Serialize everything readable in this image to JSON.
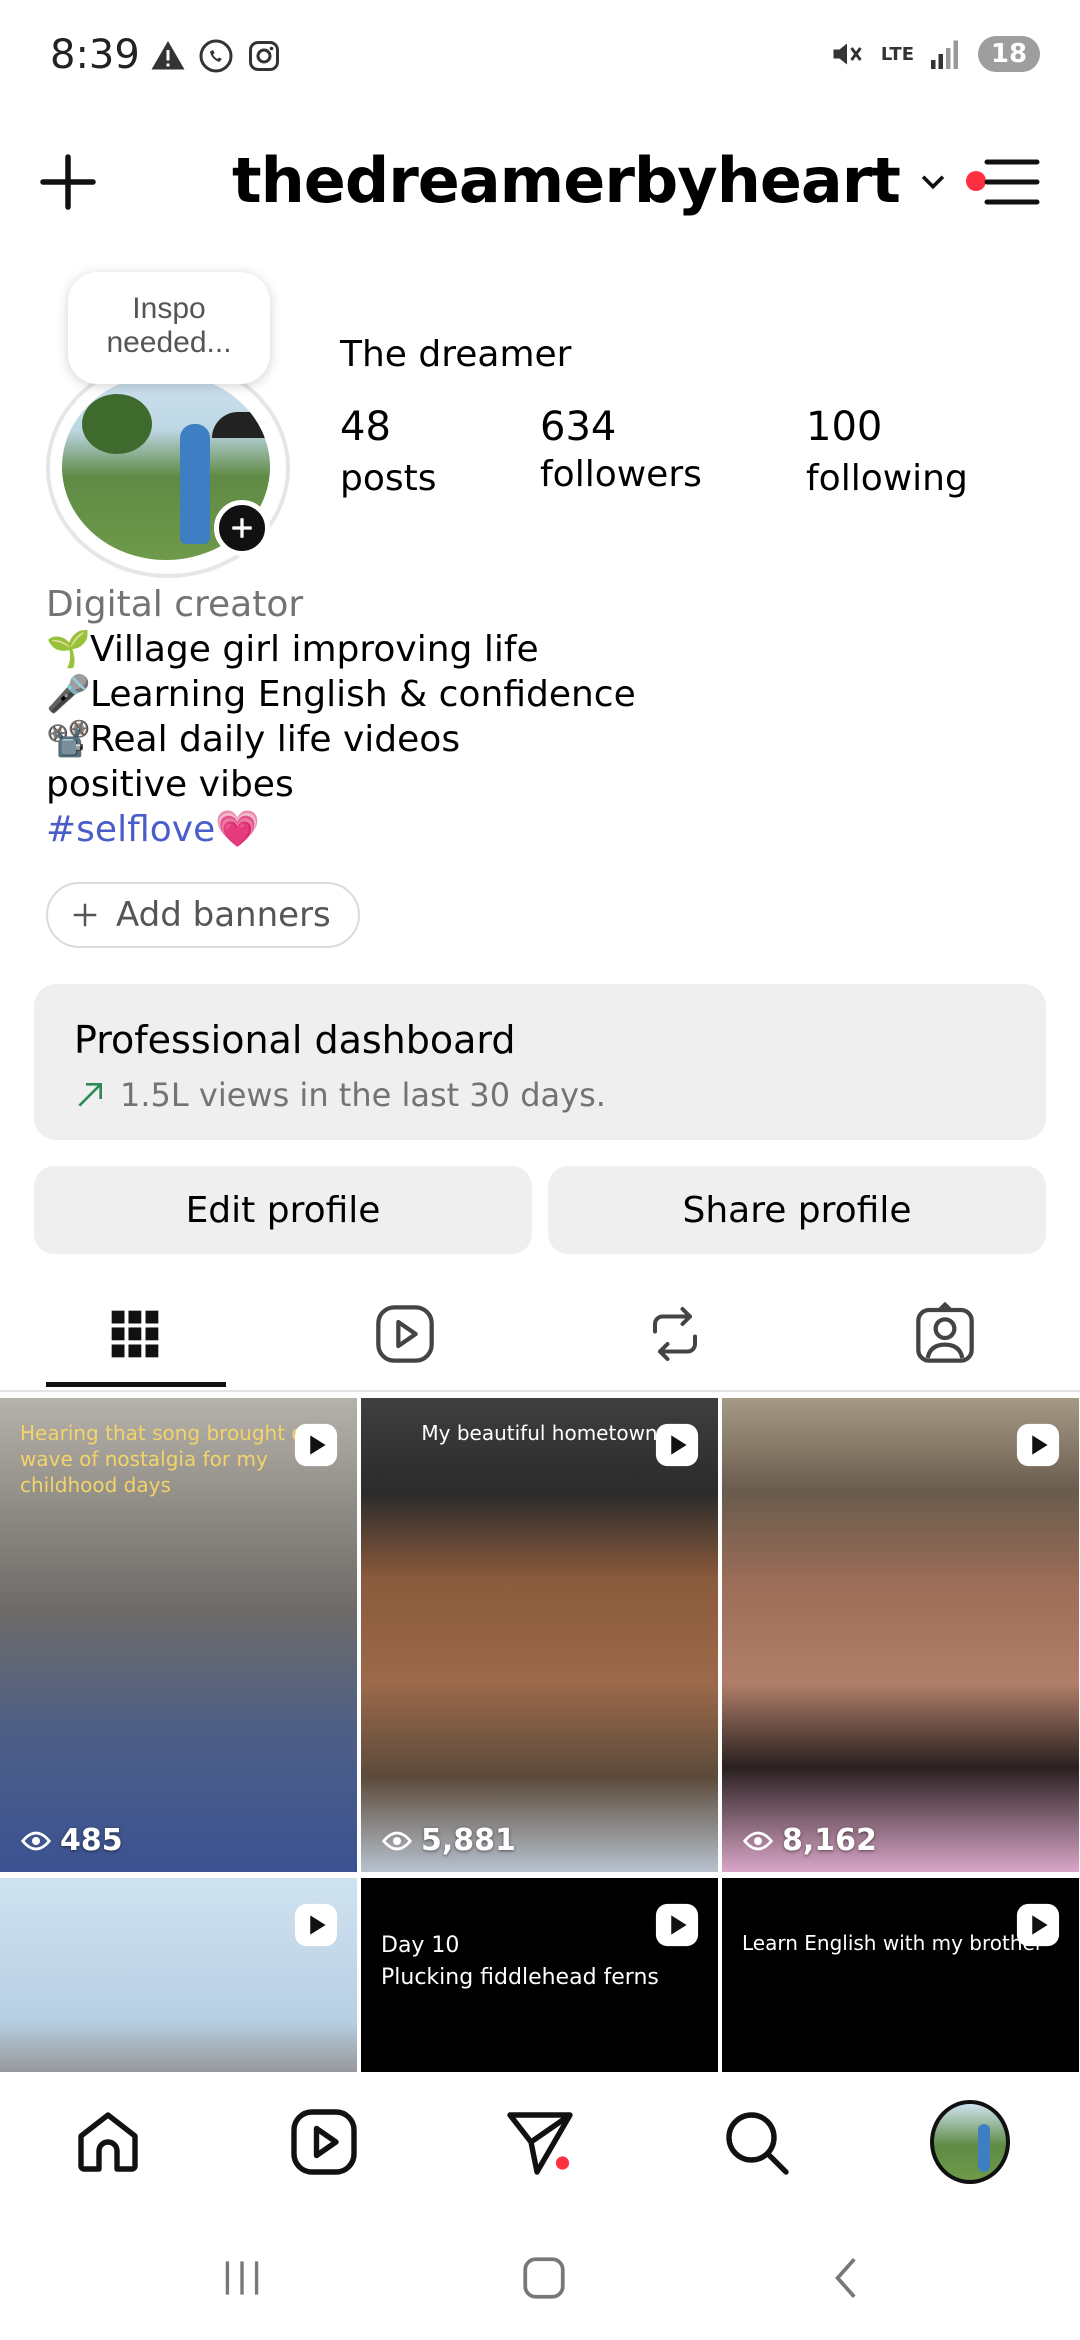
{
  "status_bar": {
    "time": "8:39",
    "battery": "18",
    "network": "LTE"
  },
  "header": {
    "username": "thedreamerbyheart"
  },
  "profile": {
    "note_line1": "Inspo",
    "note_line2": "needed...",
    "display_name": "The dreamer",
    "stats": {
      "posts": {
        "value": "48",
        "label": "posts"
      },
      "followers": {
        "value": "634",
        "label": "followers"
      },
      "following": {
        "value": "100",
        "label": "following"
      }
    }
  },
  "bio": {
    "category": "Digital creator",
    "line1_emoji": "🌱",
    "line1": "Village girl improving life",
    "line2_emoji": "🎤",
    "line2": "Learning English & confidence",
    "line3_emoji": "📽️",
    "line3": "Real daily life videos",
    "line4": "positive vibes",
    "hashtag": "#selflove",
    "heart": "💗"
  },
  "add_banners_label": "Add banners",
  "dashboard": {
    "title": "Professional dashboard",
    "subtitle": "1.5L views in the last 30 days."
  },
  "buttons": {
    "edit_profile": "Edit profile",
    "share_profile": "Share profile"
  },
  "grid": [
    {
      "caption": "Hearing that song brought on a wave of nostalgia for my childhood days",
      "views": "485"
    },
    {
      "caption": "My beautiful hometown",
      "views": "5,881"
    },
    {
      "caption": "",
      "views": "8,162"
    },
    {
      "caption": "",
      "views": ""
    },
    {
      "caption_line1": "Day 10",
      "caption_line2": "Plucking fiddlehead ferns",
      "views": ""
    },
    {
      "caption": "Learn English with my brother",
      "views": ""
    }
  ],
  "colors": {
    "accent_red": "#ff3040",
    "hashtag_blue": "#4a5dc8",
    "secondary_gray": "#737373",
    "dashboard_bg": "#efefef"
  }
}
